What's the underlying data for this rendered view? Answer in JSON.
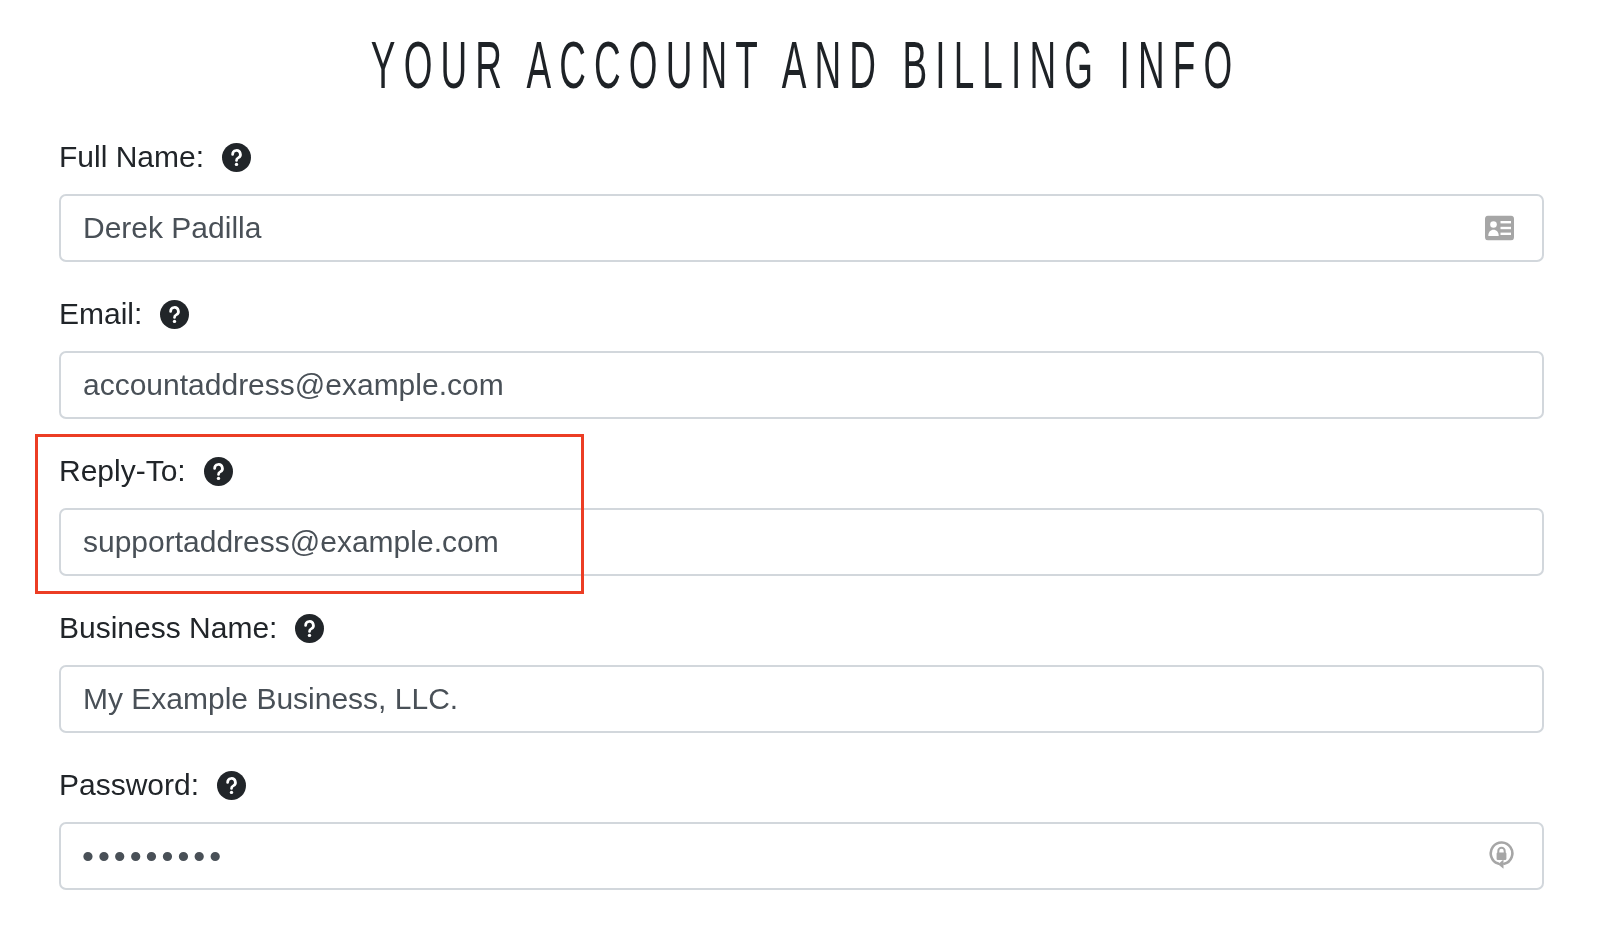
{
  "title": "YOUR ACCOUNT AND BILLING INFO",
  "fields": [
    {
      "label": "Full Name:",
      "value": "Derek Padilla",
      "kind": "contact",
      "highlighted": false
    },
    {
      "label": "Email:",
      "value": "accountaddress@example.com",
      "kind": "plain",
      "highlighted": false
    },
    {
      "label": "Reply-To:",
      "value": "supportaddress@example.com",
      "kind": "plain",
      "highlighted": true
    },
    {
      "label": "Business Name:",
      "value": "My Example Business, LLC.",
      "kind": "plain",
      "highlighted": false
    },
    {
      "label": "Password:",
      "value": "•••••••••",
      "kind": "password",
      "highlighted": false
    }
  ]
}
